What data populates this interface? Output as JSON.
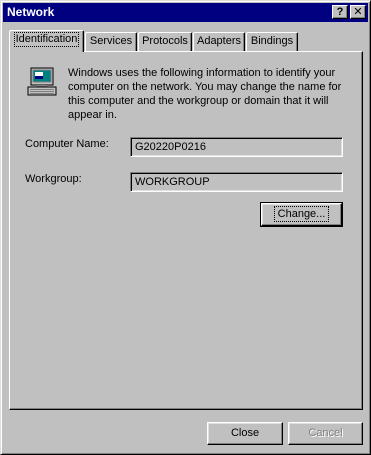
{
  "window": {
    "title": "Network",
    "help_button": "?",
    "close_button": "✕"
  },
  "tabs": [
    {
      "label": "Identification",
      "active": true
    },
    {
      "label": "Services",
      "active": false
    },
    {
      "label": "Protocols",
      "active": false
    },
    {
      "label": "Adapters",
      "active": false
    },
    {
      "label": "Bindings",
      "active": false
    }
  ],
  "identification": {
    "icon": "computer-icon",
    "description": "Windows uses the following information to identify your computer on the network.  You may change the name for this computer and the workgroup or domain that it will appear in.",
    "computer_name_label": "Computer Name:",
    "computer_name_value": "G20220P0216",
    "workgroup_label": "Workgroup:",
    "workgroup_value": "WORKGROUP",
    "change_button": "Change..."
  },
  "footer": {
    "close_button": "Close",
    "cancel_button": "Cancel"
  },
  "colors": {
    "titlebar": "#000080",
    "face": "#c0c0c0"
  }
}
